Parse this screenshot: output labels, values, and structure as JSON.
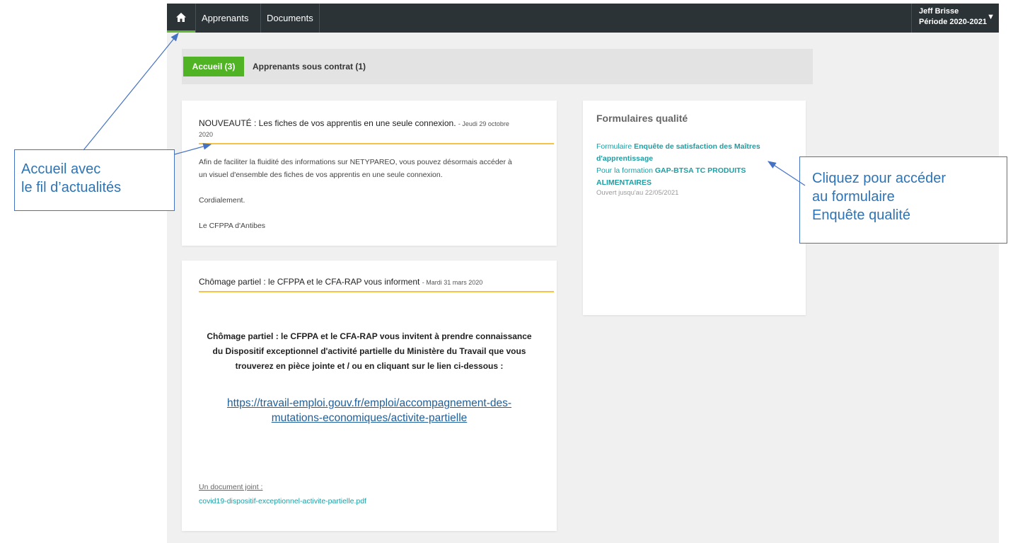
{
  "navbar": {
    "items": [
      "Apprenants",
      "Documents"
    ],
    "user_name": "Jeff Brisse",
    "period": "Période 2020-2021",
    "caret": "▼"
  },
  "tabs": {
    "active": "Accueil (3)",
    "other": "Apprenants sous contrat (1)"
  },
  "news": [
    {
      "title": "NOUVEAUTÉ : Les fiches de vos apprentis en une seule connexion.",
      "date_line1": "- Jeudi 29 octobre",
      "date_line2": "2020",
      "body_line1": "Afin de faciliter la fluidité des informations sur NETYPAREO, vous pouvez désormais accéder à",
      "body_line2": "un visuel d'ensemble des fiches de vos apprentis en une seule connexion.",
      "greeting": "Cordialement.",
      "signature": "Le CFPPA d'Antibes"
    },
    {
      "title": "Chômage partiel : le CFPPA et le CFA-RAP vous informent",
      "date": "- Mardi 31 mars 2020",
      "bold_line1": "Chômage partiel : le CFPPA et le CFA-RAP vous invitent à prendre connaissance",
      "bold_line2": "du Dispositif exceptionnel d'activité partielle du Ministère du Travail que vous",
      "bold_line3": "trouverez en pièce jointe et / ou en cliquant sur le lien ci-dessous :",
      "link_line1": "https://travail-emploi.gouv.fr/emploi/accompagnement-des-",
      "link_line2": "mutations-economiques/activite-partielle",
      "attachment_label": "Un document joint :",
      "attachment_file": "covid19-dispositif-exceptionnel-activite-partielle.pdf"
    }
  ],
  "forms": {
    "title": "Formulaires qualité",
    "prefix": "Formulaire ",
    "form_name_line1": "Enquête de satisfaction des Maîtres",
    "form_name_line2": "d'apprentissage",
    "training_prefix": "Pour la formation ",
    "training_line1": "GAP-BTSA TC PRODUITS",
    "training_line2": "ALIMENTAIRES",
    "open_until": "Ouvert jusqu'au 22/05/2021"
  },
  "callouts": {
    "left_line1": "Accueil avec",
    "left_line2": "le fil d’actualités",
    "right_line1": "Cliquez pour accéder",
    "right_line2": "au formulaire",
    "right_line3": "Enquête qualité"
  },
  "colors": {
    "navbar": "#2b3336",
    "accent_green": "#4fb324",
    "underline_yellow": "#f5c24a",
    "link_teal": "#1d9ea3",
    "callout_blue": "#4472c4"
  },
  "icons": {
    "home": "home-icon"
  }
}
